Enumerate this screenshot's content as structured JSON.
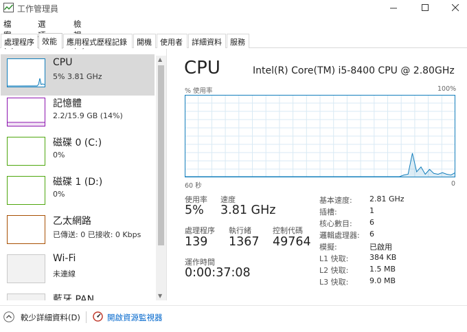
{
  "window": {
    "title": "工作管理員"
  },
  "menu": [
    "檔案(F)",
    "選項(O)",
    "檢視(V)"
  ],
  "tabs": [
    "處理程序",
    "效能",
    "應用程式歷程記錄",
    "開機",
    "使用者",
    "詳細資料",
    "服務"
  ],
  "resources": [
    {
      "name": "CPU",
      "sub": "5% 3.81 GHz",
      "color": "#117dbb",
      "active": true
    },
    {
      "name": "記憶體",
      "sub": "2.2/15.9 GB (14%)",
      "color": "#8b12ae"
    },
    {
      "name": "磁碟 0 (C:)",
      "sub": "0%",
      "color": "#4da60c"
    },
    {
      "name": "磁碟 1 (D:)",
      "sub": "0%",
      "color": "#4da60c"
    },
    {
      "name": "乙太網路",
      "sub": "已傳送: 0 已接收: 0 Kbps",
      "color": "#a74f01"
    },
    {
      "name": "Wi-Fi",
      "sub": "未連線",
      "color": "#c8c8c8"
    },
    {
      "name": "藍牙 PAN",
      "sub": "",
      "color": "#c8c8c8"
    }
  ],
  "detail": {
    "title": "CPU",
    "model": "Intel(R) Core(TM) i5-8400 CPU @ 2.80GHz",
    "usage_axis_label": "% 使用率",
    "usage_axis_max": "100%",
    "time_axis_label": "60 秒",
    "time_axis_end": "0",
    "graph_color": "#117dbb",
    "usage_history_percent": [
      0,
      0,
      0,
      0,
      0,
      0,
      0,
      0,
      0,
      0,
      0,
      0,
      0,
      0,
      0,
      0,
      0,
      0,
      0,
      0,
      0,
      0,
      0,
      0,
      0,
      0,
      0,
      0,
      0,
      0,
      0,
      0,
      0,
      0,
      0,
      0,
      0,
      0,
      0,
      0,
      0,
      0,
      0,
      0,
      0,
      0,
      0,
      0,
      0,
      0,
      0,
      2,
      3,
      29,
      6,
      12,
      3,
      9,
      4,
      3,
      5,
      3,
      2,
      5
    ]
  },
  "stats": {
    "usage_label": "使用率",
    "usage_value": "5%",
    "speed_label": "速度",
    "speed_value": "3.81 GHz",
    "processes_label": "處理程序",
    "processes_value": "139",
    "threads_label": "執行緒",
    "threads_value": "1367",
    "handles_label": "控制代碼",
    "handles_value": "49764",
    "uptime_label": "運作時間",
    "uptime_value": "0:00:37:08"
  },
  "specs": [
    {
      "k": "基本速度:",
      "v": "2.81 GHz"
    },
    {
      "k": "插槽:",
      "v": "1"
    },
    {
      "k": "核心數目:",
      "v": "6"
    },
    {
      "k": "邏輯處理器:",
      "v": "6"
    },
    {
      "k": "模擬:",
      "v": "已啟用"
    },
    {
      "k": "L1 快取:",
      "v": "384 KB"
    },
    {
      "k": "L2 快取:",
      "v": "1.5 MB"
    },
    {
      "k": "L3 快取:",
      "v": "9.0 MB"
    }
  ],
  "footer": {
    "fewer_details": "較少詳細資料(D)",
    "open_resmon": "開啟資源監視器"
  }
}
